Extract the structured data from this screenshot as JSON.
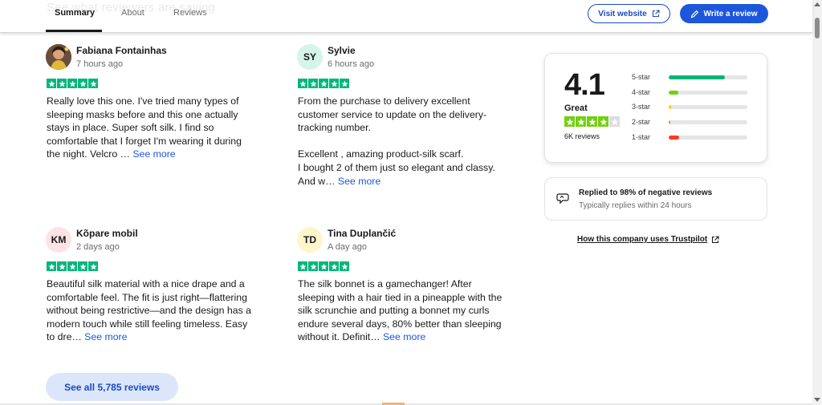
{
  "nav": {
    "ghost_heading": "See what reviewers are saying",
    "tabs": [
      {
        "label": "Summary"
      },
      {
        "label": "About"
      },
      {
        "label": "Reviews"
      }
    ],
    "visit_label": "Visit website",
    "write_label": "Write a review"
  },
  "reviews": [
    {
      "name": "Fabiana Fontainhas",
      "date": "7 hours ago",
      "initials": "",
      "stars": 5,
      "text": "Really love this one. I've tried many types of sleeping masks before and this one actually stays in place. Super soft silk. I find so comfortable that I forget I'm wearing it during the night. Velcro …",
      "more": "See more"
    },
    {
      "name": "Sylvie",
      "date": "6 hours ago",
      "initials": "SY",
      "stars": 5,
      "text": "From the purchase to delivery excellent customer service to update on the delivery-tracking number.\n\nExcellent , amazing product-silk scarf.\nI bought 2 of them just so elegant and classy.\nAnd w…",
      "more": "See more"
    },
    {
      "name": "Kõpare mobil",
      "date": "2 days ago",
      "initials": "KM",
      "stars": 5,
      "text": "Beautiful silk material with a nice drape and a comfortable feel. The fit is just right—flattering without being restrictive—and the design has a modern touch while still feeling timeless. Easy to dre…",
      "more": "See more"
    },
    {
      "name": "Tina Duplančić",
      "date": "A day ago",
      "initials": "TD",
      "stars": 5,
      "text": "The silk bonnet is a gamechanger! After sleeping with a hair tied in a pineapple with the silk scrunchie and putting a bonnet my curls endure several days, 80% better than sleeping without it. Definit…",
      "more": "See more"
    }
  ],
  "rating": {
    "score": "4.1",
    "word": "Great",
    "stars_filled": 4,
    "stars_total": 5,
    "count": "6K reviews",
    "distribution": [
      {
        "label": "5-star",
        "fraction": 0.71
      },
      {
        "label": "4-star",
        "fraction": 0.12
      },
      {
        "label": "3-star",
        "fraction": 0.03
      },
      {
        "label": "2-star",
        "fraction": 0.02
      },
      {
        "label": "1-star",
        "fraction": 0.13
      }
    ]
  },
  "reply": {
    "title": "Replied to 98% of negative reviews",
    "subtitle": "Typically replies within 24 hours"
  },
  "company_link": "How this company uses Trustpilot",
  "see_all_label": "See all 5,785 reviews",
  "colors": {
    "star_green": "#00b67a",
    "star_light_green": "#73cf11",
    "star_empty": "#dcdce6",
    "brand_blue": "#1c57db",
    "bar_5": "#00b67a",
    "bar_4": "#73cf11",
    "bar_3": "#ffce00",
    "bar_2": "#ff8622",
    "bar_1": "#ff3722",
    "avatar_sy": "#d5f5ea",
    "avatar_km": "#fde2e6",
    "avatar_td": "#fff5cc"
  },
  "icons": {
    "external": "external-link-icon",
    "pencil": "pencil-icon",
    "reply": "speech-bubble-icon"
  }
}
